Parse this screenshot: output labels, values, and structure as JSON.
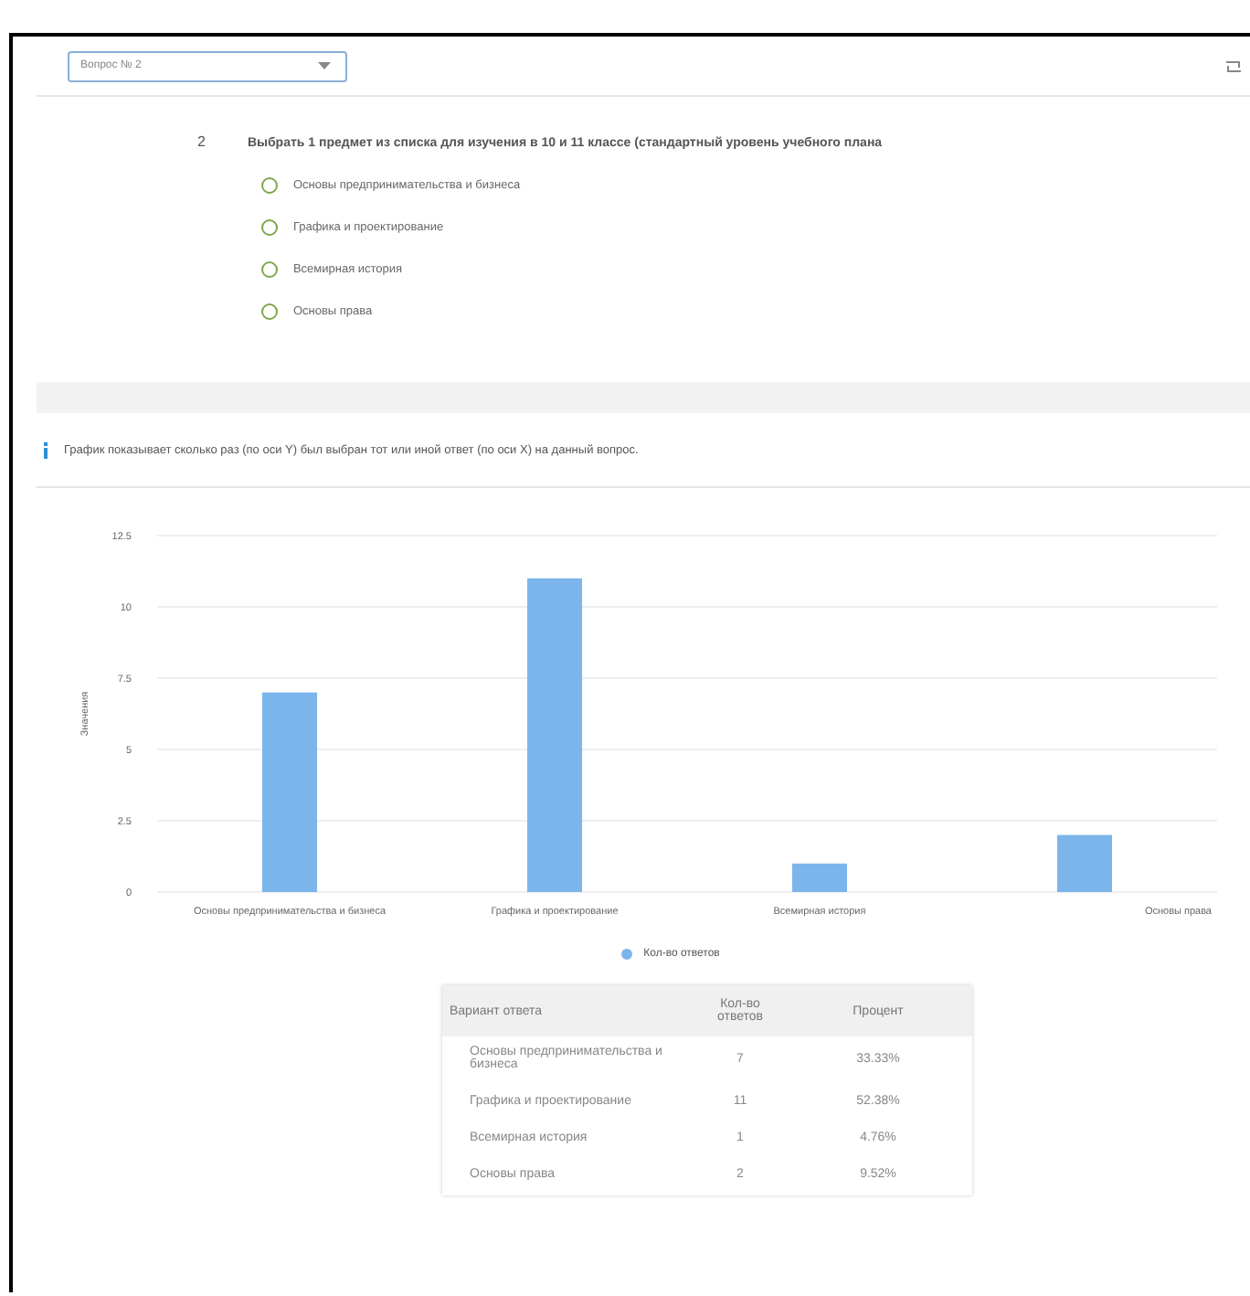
{
  "question_select": {
    "value": "Вопрос № 2"
  },
  "question": {
    "number": "2",
    "text": "Выбрать 1 предмет из списка для изучения в 10 и 11 классе (стандартный уровень учебного плана",
    "options": [
      {
        "label": "Основы предпринимательства и бизнеса",
        "selected": false
      },
      {
        "label": "Графика и проектирование",
        "selected": false
      },
      {
        "label": "Всемирная история",
        "selected": false
      },
      {
        "label": "Основы права",
        "selected": false
      }
    ]
  },
  "info": "График показывает сколько раз (по оси Y) был выбран тот или иной ответ (по оси X) на данный вопрос.",
  "chart": {
    "chart_data": {
      "type": "bar",
      "ylabel": "Значения",
      "categories": [
        "Основы предпринимательства и бизнеса",
        "Графика и проектирование",
        "Всемирная история",
        "Основы права"
      ],
      "series": [
        {
          "name": "Кол-во ответов",
          "color": "#7cb5ec",
          "values": [
            7,
            11,
            1,
            2
          ]
        }
      ],
      "ylim": [
        0,
        12.5
      ],
      "grid": true,
      "yticks": [
        0,
        {
          "value": 2.5,
          "label": "2.5"
        },
        5,
        {
          "value": 7.5,
          "label": "7.5"
        },
        10,
        {
          "value": 12.5,
          "label": "12.5"
        }
      ]
    }
  },
  "table": {
    "columns": [
      "Вариант ответа",
      "Кол-во ответов",
      "Процент"
    ],
    "rows": [
      [
        "Основы предпринимательства и бизнеса",
        "7",
        "33.33%"
      ],
      [
        "Графика и проектирование",
        "11",
        "52.38%"
      ],
      [
        "Всемирная история",
        "1",
        "4.76%"
      ],
      [
        "Основы права",
        "2",
        "9.52%"
      ]
    ]
  }
}
